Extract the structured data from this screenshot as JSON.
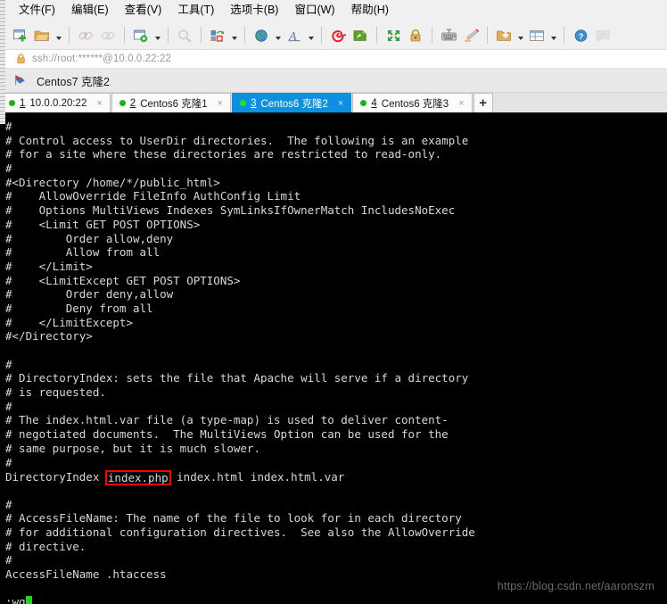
{
  "menubar": {
    "items": [
      {
        "label": "文件(F)",
        "name": "menu-file"
      },
      {
        "label": "编辑(E)",
        "name": "menu-edit"
      },
      {
        "label": "查看(V)",
        "name": "menu-view"
      },
      {
        "label": "工具(T)",
        "name": "menu-tools"
      },
      {
        "label": "选项卡(B)",
        "name": "menu-tabs"
      },
      {
        "label": "窗口(W)",
        "name": "menu-window"
      },
      {
        "label": "帮助(H)",
        "name": "menu-help"
      }
    ]
  },
  "toolbar": {
    "buttons": [
      {
        "name": "new-session-icon",
        "title": "新建会话"
      },
      {
        "name": "open-folder-icon",
        "title": "打开"
      },
      {
        "name": "disconnect-icon",
        "title": "断开"
      },
      {
        "name": "reconnect-icon",
        "title": "重新连接"
      },
      {
        "name": "session-properties-icon",
        "title": "属性"
      },
      {
        "name": "find-icon",
        "title": "查找"
      },
      {
        "name": "transfer-file-icon",
        "title": "传输文件"
      },
      {
        "name": "globe-icon",
        "title": "编码"
      },
      {
        "name": "font-icon",
        "title": "字体"
      },
      {
        "name": "nautilus-icon",
        "title": "日志"
      },
      {
        "name": "xftp-icon",
        "title": "新建文件传输"
      },
      {
        "name": "fullscreen-icon",
        "title": "全屏"
      },
      {
        "name": "lock-icon",
        "title": "锁定"
      },
      {
        "name": "keyboard-icon",
        "title": "键盘"
      },
      {
        "name": "highlight-pen-icon",
        "title": "高亮"
      },
      {
        "name": "add-folder-icon",
        "title": "新建文件夹"
      },
      {
        "name": "split-view-icon",
        "title": "排列"
      },
      {
        "name": "help-icon",
        "title": "帮助"
      },
      {
        "name": "comment-icon",
        "title": "反馈"
      }
    ]
  },
  "addressbar": {
    "lock_icon": "lock-icon",
    "url": "ssh://root:******@10.0.0.22:22"
  },
  "session": {
    "icon": "session-flag-icon",
    "title": "Centos7 克隆2"
  },
  "tabs": {
    "items": [
      {
        "num": "1",
        "label": "10.0.0.20:22",
        "active": false,
        "status": "connected"
      },
      {
        "num": "2",
        "label": "Centos6 克隆1",
        "active": false,
        "status": "connected"
      },
      {
        "num": "3",
        "label": "Centos6 克隆2",
        "active": true,
        "status": "connected"
      },
      {
        "num": "4",
        "label": "Centos6 克隆3",
        "active": false,
        "status": "connected"
      }
    ],
    "close_glyph": "×",
    "add_glyph": "+"
  },
  "terminal": {
    "lines": [
      "#",
      "# Control access to UserDir directories.  The following is an example",
      "# for a site where these directories are restricted to read-only.",
      "#",
      "#<Directory /home/*/public_html>",
      "#    AllowOverride FileInfo AuthConfig Limit",
      "#    Options MultiViews Indexes SymLinksIfOwnerMatch IncludesNoExec",
      "#    <Limit GET POST OPTIONS>",
      "#        Order allow,deny",
      "#        Allow from all",
      "#    </Limit>",
      "#    <LimitExcept GET POST OPTIONS>",
      "#        Order deny,allow",
      "#        Deny from all",
      "#    </LimitExcept>",
      "#</Directory>",
      "",
      "#",
      "# DirectoryIndex: sets the file that Apache will serve if a directory",
      "# is requested.",
      "#",
      "# The index.html.var file (a type-map) is used to deliver content-",
      "# negotiated documents.  The MultiViews Option can be used for the",
      "# same purpose, but it is much slower.",
      "#"
    ],
    "directory_index": {
      "prefix": "DirectoryIndex ",
      "highlighted": "index.php",
      "suffix": " index.html index.html.var",
      "highlight_color": "#ff0000"
    },
    "lines_after": [
      "",
      "#",
      "# AccessFileName: The name of the file to look for in each directory",
      "# for additional configuration directives.  See also the AllowOverride",
      "# directive.",
      "#",
      "AccessFileName .htaccess",
      ""
    ],
    "prompt": ":wq",
    "cursor_color": "#19d719",
    "background": "#000000",
    "foreground": "#d8d8d8"
  },
  "watermark": {
    "text": "https://blog.csdn.net/aaronszm"
  }
}
